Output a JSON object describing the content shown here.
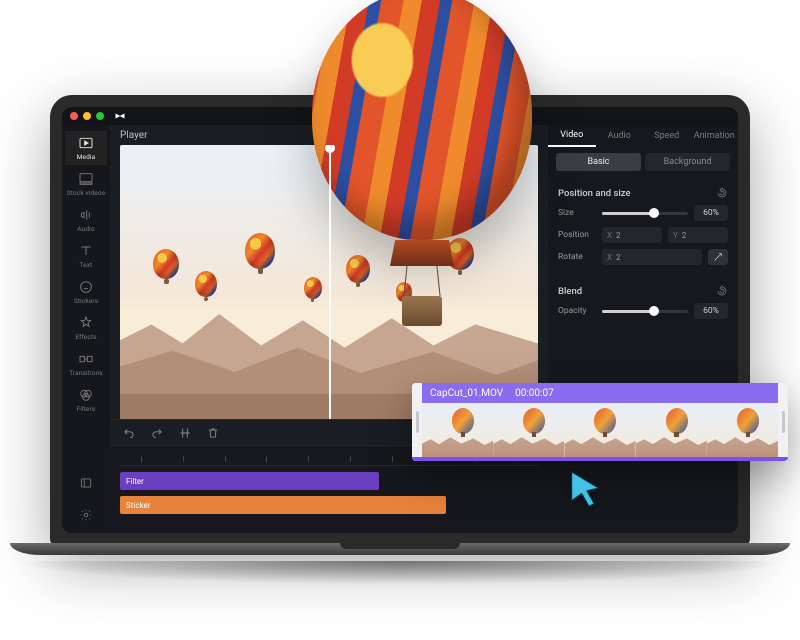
{
  "app_name": "CapCut",
  "sidebar": {
    "items": [
      {
        "label": "Media",
        "icon": "media"
      },
      {
        "label": "Stock videos",
        "icon": "stock"
      },
      {
        "label": "Audio",
        "icon": "audio"
      },
      {
        "label": "Text",
        "icon": "text"
      },
      {
        "label": "Stickers",
        "icon": "stickers"
      },
      {
        "label": "Effects",
        "icon": "effects"
      },
      {
        "label": "Transitions",
        "icon": "transitions"
      },
      {
        "label": "Filters",
        "icon": "filters"
      }
    ]
  },
  "player": {
    "title": "Player"
  },
  "timeline": {
    "tracks": [
      {
        "label": "Filter",
        "color": "#6b3fbf"
      },
      {
        "label": "Sticker",
        "color": "#e8833c"
      }
    ]
  },
  "panel": {
    "tabs": [
      "Video",
      "Audio",
      "Speed",
      "Animation"
    ],
    "subtabs": [
      "Basic",
      "Background"
    ],
    "position_section": {
      "title": "Position and size",
      "size_label": "Size",
      "size_value": "60%",
      "size_pct": 60,
      "position_label": "Position",
      "pos_x_lbl": "X",
      "pos_x": "2",
      "pos_y_lbl": "Y",
      "pos_y": "2",
      "rotate_label": "Rotate",
      "rot_x_lbl": "X",
      "rot_x": "2"
    },
    "blend_section": {
      "title": "Blend",
      "opacity_label": "Opacity",
      "opacity_value": "60%",
      "opacity_pct": 60
    }
  },
  "clip": {
    "filename": "CapCut_01.MOV",
    "timecode": "00:00:07"
  }
}
